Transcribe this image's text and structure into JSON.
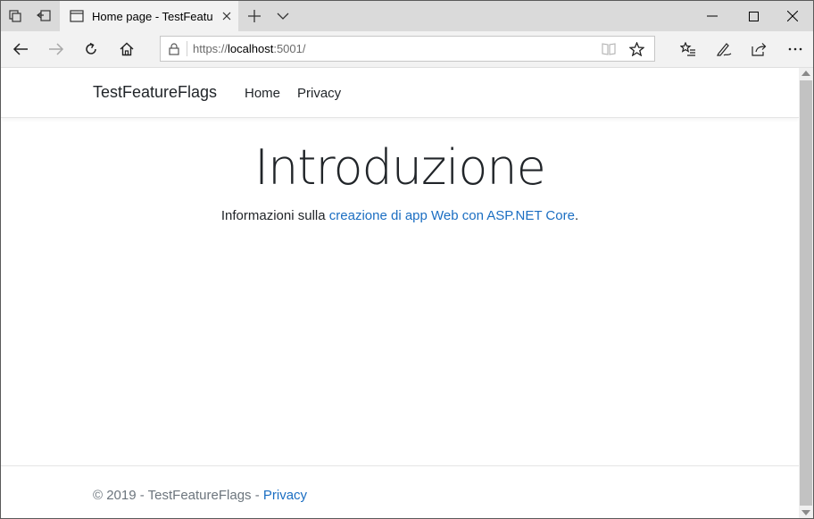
{
  "browser": {
    "tab": {
      "title": "Home page - TestFeatur"
    },
    "address": {
      "scheme": "https://",
      "host": "localhost",
      "rest": ":5001/"
    }
  },
  "page": {
    "navbar": {
      "brand": "TestFeatureFlags",
      "links": [
        "Home",
        "Privacy"
      ]
    },
    "hero": {
      "title": "Introduzione",
      "text_before": "Informazioni sulla ",
      "link": "creazione di app Web con ASP.NET Core",
      "text_after": "."
    },
    "footer": {
      "copyright": "© 2019 - TestFeatureFlags - ",
      "link": "Privacy"
    }
  },
  "colors": {
    "link": "#1b6ec2",
    "tab_active": "#f2f2f2",
    "tab_strip": "#dadada"
  }
}
